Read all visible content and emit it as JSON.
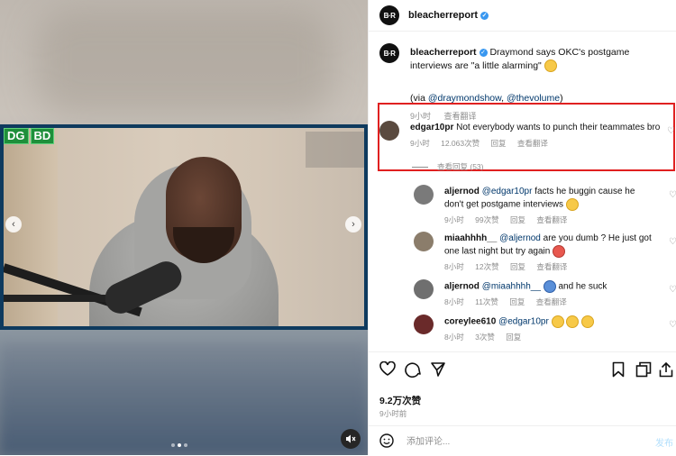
{
  "media": {
    "watermark_left": [
      "DG",
      "BD"
    ],
    "prev_icon": "chevron-left-icon",
    "next_icon": "chevron-right-icon",
    "mute_icon": "speaker-muted-icon",
    "carousel": {
      "count": 3,
      "active": 2
    }
  },
  "header": {
    "avatar_text": "B·R",
    "username": "bleacherreport",
    "verified": true
  },
  "caption": {
    "username": "bleacherreport",
    "text": "Draymond says OKC's postgame interviews are \"a little alarming\"",
    "via_prefix": "(via ",
    "mention1": "@draymondshow",
    "separator": ", ",
    "mention2": "@thevolume",
    "via_suffix": ")",
    "time": "9小时",
    "translate": "查看翻译"
  },
  "comments": [
    {
      "username": "edgar10pr",
      "text": "Not everybody wants to punch their teammates bro",
      "time": "9小时",
      "likes": "12.063次赞",
      "reply": "回复",
      "translate": "查看翻译",
      "view_replies": "查看回复 (53)"
    },
    {
      "username": "aljernod",
      "mention": "@edgar10pr",
      "text": "facts he buggin cause he don't get postgame interviews",
      "time": "9小时",
      "likes": "99次赞",
      "reply": "回复",
      "translate": "查看翻译"
    },
    {
      "username": "miaahhhh__",
      "mention": "@aljernod",
      "text": "are you dumb ? He just got one last night but try again",
      "time": "8小时",
      "likes": "12次赞",
      "reply": "回复",
      "translate": "查看翻译"
    },
    {
      "username": "aljernod",
      "mention": "@miaahhhh__",
      "text": "and he suck",
      "time": "8小时",
      "likes": "11次赞",
      "reply": "回复",
      "translate": "查看翻译"
    },
    {
      "username": "coreylee610",
      "mention": "@edgar10pr",
      "text": "",
      "time": "8小时",
      "likes": "3次赞",
      "reply": "回复"
    }
  ],
  "actions": {
    "like_icon": "heart-icon",
    "comment_icon": "comment-icon",
    "share_icon": "send-icon",
    "save_icon": "bookmark-icon",
    "copy_icon": "copy-icon",
    "upload_icon": "upload-icon"
  },
  "post": {
    "likes": "9.2万次赞",
    "time": "9小时前"
  },
  "composer": {
    "placeholder": "添加评论...",
    "post_label": "发布",
    "emoji_icon": "smile-icon"
  },
  "colors": {
    "link": "#00376b",
    "verified": "#3897f0",
    "highlight": "#e02020",
    "muted": "#8e8e8e"
  }
}
